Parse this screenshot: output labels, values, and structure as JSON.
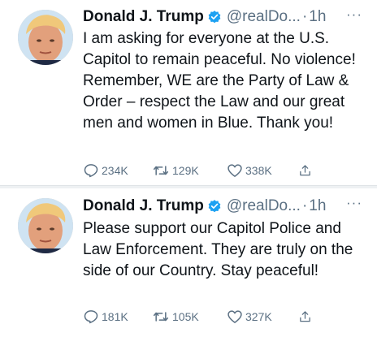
{
  "tweets": [
    {
      "author_name": "Donald J. Trump",
      "handle": "@realDo...",
      "separator": "·",
      "time": "1h",
      "more": "···",
      "text": "I am asking for everyone at the U.S. Capitol to remain peaceful. No violence! Remember, WE are the Party of Law & Order – respect the Law and our great men and women in Blue. Thank you!",
      "replies": "234K",
      "retweets": "129K",
      "likes": "338K"
    },
    {
      "author_name": "Donald J. Trump",
      "handle": "@realDo...",
      "separator": "·",
      "time": "1h",
      "more": "···",
      "text": "Please support our Capitol Police and Law Enforcement. They are truly on the side of our Country. Stay peaceful!",
      "replies": "181K",
      "retweets": "105K",
      "likes": "327K"
    }
  ],
  "icons": {
    "verified": "verified-badge-icon",
    "reply": "reply-icon",
    "retweet": "retweet-icon",
    "like": "heart-icon",
    "share": "share-icon",
    "more": "more-icon"
  },
  "colors": {
    "verified_blue": "#1da1f2",
    "text": "#0f1419",
    "secondary": "#5b7083",
    "divider": "#eef1f3"
  }
}
